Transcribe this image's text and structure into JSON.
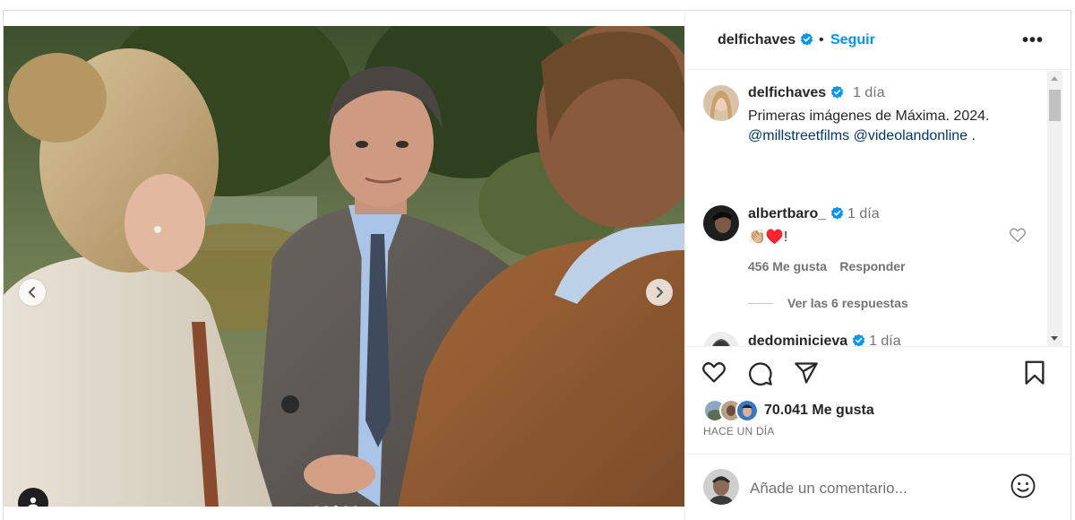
{
  "post": {
    "username": "delfichaves",
    "separator": "•",
    "follow_label": "Seguir",
    "more_label": "•••"
  },
  "media": {
    "slide_count": 5,
    "active_slide": 3
  },
  "comments": [
    {
      "username": "delfichaves",
      "time": "1 día",
      "text": "Primeras imágenes de Máxima. 2024.",
      "mentions": [
        "@millstreetfilms",
        "@videolandonline"
      ],
      "mention_tail": "."
    },
    {
      "username": "albertbaro_",
      "time": "1 día",
      "text": "👏🏼♥️!",
      "likes": "456 Me gusta",
      "reply_label": "Responder",
      "view_replies": "Ver las 6 respuestas"
    },
    {
      "username": "dedominicieva",
      "time": "1 día"
    }
  ],
  "footer": {
    "likes": "70.041 Me gusta",
    "time_ago": "HACE UN DÍA",
    "comment_placeholder": "Añade un comentario..."
  },
  "icons": {
    "verified": "verified-badge-icon",
    "like": "heart-icon",
    "comment": "comment-icon",
    "share": "share-icon",
    "save": "bookmark-icon",
    "emoji": "smiley-icon",
    "user_tag": "user-tag-icon"
  },
  "colors": {
    "accent": "#0095f6",
    "verified": "#0095f6",
    "mention": "#00376b",
    "muted": "#737373"
  }
}
